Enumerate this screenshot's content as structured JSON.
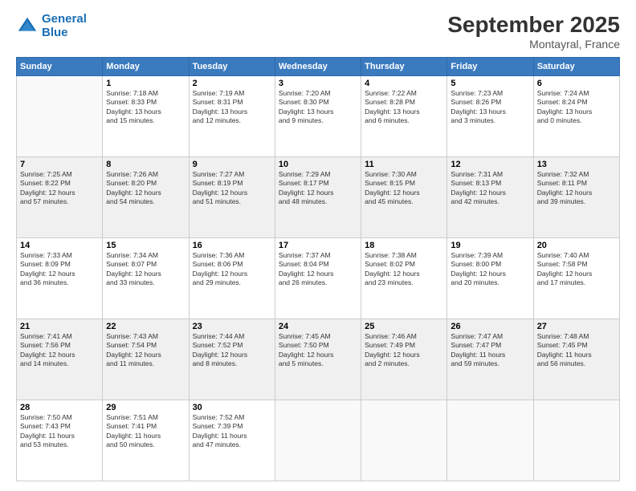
{
  "logo": {
    "line1": "General",
    "line2": "Blue"
  },
  "title": "September 2025",
  "subtitle": "Montayral, France",
  "header_days": [
    "Sunday",
    "Monday",
    "Tuesday",
    "Wednesday",
    "Thursday",
    "Friday",
    "Saturday"
  ],
  "weeks": [
    [
      {
        "day": "",
        "info": ""
      },
      {
        "day": "1",
        "info": "Sunrise: 7:18 AM\nSunset: 8:33 PM\nDaylight: 13 hours\nand 15 minutes."
      },
      {
        "day": "2",
        "info": "Sunrise: 7:19 AM\nSunset: 8:31 PM\nDaylight: 13 hours\nand 12 minutes."
      },
      {
        "day": "3",
        "info": "Sunrise: 7:20 AM\nSunset: 8:30 PM\nDaylight: 13 hours\nand 9 minutes."
      },
      {
        "day": "4",
        "info": "Sunrise: 7:22 AM\nSunset: 8:28 PM\nDaylight: 13 hours\nand 6 minutes."
      },
      {
        "day": "5",
        "info": "Sunrise: 7:23 AM\nSunset: 8:26 PM\nDaylight: 13 hours\nand 3 minutes."
      },
      {
        "day": "6",
        "info": "Sunrise: 7:24 AM\nSunset: 8:24 PM\nDaylight: 13 hours\nand 0 minutes."
      }
    ],
    [
      {
        "day": "7",
        "info": "Sunrise: 7:25 AM\nSunset: 8:22 PM\nDaylight: 12 hours\nand 57 minutes."
      },
      {
        "day": "8",
        "info": "Sunrise: 7:26 AM\nSunset: 8:20 PM\nDaylight: 12 hours\nand 54 minutes."
      },
      {
        "day": "9",
        "info": "Sunrise: 7:27 AM\nSunset: 8:19 PM\nDaylight: 12 hours\nand 51 minutes."
      },
      {
        "day": "10",
        "info": "Sunrise: 7:29 AM\nSunset: 8:17 PM\nDaylight: 12 hours\nand 48 minutes."
      },
      {
        "day": "11",
        "info": "Sunrise: 7:30 AM\nSunset: 8:15 PM\nDaylight: 12 hours\nand 45 minutes."
      },
      {
        "day": "12",
        "info": "Sunrise: 7:31 AM\nSunset: 8:13 PM\nDaylight: 12 hours\nand 42 minutes."
      },
      {
        "day": "13",
        "info": "Sunrise: 7:32 AM\nSunset: 8:11 PM\nDaylight: 12 hours\nand 39 minutes."
      }
    ],
    [
      {
        "day": "14",
        "info": "Sunrise: 7:33 AM\nSunset: 8:09 PM\nDaylight: 12 hours\nand 36 minutes."
      },
      {
        "day": "15",
        "info": "Sunrise: 7:34 AM\nSunset: 8:07 PM\nDaylight: 12 hours\nand 33 minutes."
      },
      {
        "day": "16",
        "info": "Sunrise: 7:36 AM\nSunset: 8:06 PM\nDaylight: 12 hours\nand 29 minutes."
      },
      {
        "day": "17",
        "info": "Sunrise: 7:37 AM\nSunset: 8:04 PM\nDaylight: 12 hours\nand 26 minutes."
      },
      {
        "day": "18",
        "info": "Sunrise: 7:38 AM\nSunset: 8:02 PM\nDaylight: 12 hours\nand 23 minutes."
      },
      {
        "day": "19",
        "info": "Sunrise: 7:39 AM\nSunset: 8:00 PM\nDaylight: 12 hours\nand 20 minutes."
      },
      {
        "day": "20",
        "info": "Sunrise: 7:40 AM\nSunset: 7:58 PM\nDaylight: 12 hours\nand 17 minutes."
      }
    ],
    [
      {
        "day": "21",
        "info": "Sunrise: 7:41 AM\nSunset: 7:56 PM\nDaylight: 12 hours\nand 14 minutes."
      },
      {
        "day": "22",
        "info": "Sunrise: 7:43 AM\nSunset: 7:54 PM\nDaylight: 12 hours\nand 11 minutes."
      },
      {
        "day": "23",
        "info": "Sunrise: 7:44 AM\nSunset: 7:52 PM\nDaylight: 12 hours\nand 8 minutes."
      },
      {
        "day": "24",
        "info": "Sunrise: 7:45 AM\nSunset: 7:50 PM\nDaylight: 12 hours\nand 5 minutes."
      },
      {
        "day": "25",
        "info": "Sunrise: 7:46 AM\nSunset: 7:49 PM\nDaylight: 12 hours\nand 2 minutes."
      },
      {
        "day": "26",
        "info": "Sunrise: 7:47 AM\nSunset: 7:47 PM\nDaylight: 11 hours\nand 59 minutes."
      },
      {
        "day": "27",
        "info": "Sunrise: 7:48 AM\nSunset: 7:45 PM\nDaylight: 11 hours\nand 56 minutes."
      }
    ],
    [
      {
        "day": "28",
        "info": "Sunrise: 7:50 AM\nSunset: 7:43 PM\nDaylight: 11 hours\nand 53 minutes."
      },
      {
        "day": "29",
        "info": "Sunrise: 7:51 AM\nSunset: 7:41 PM\nDaylight: 11 hours\nand 50 minutes."
      },
      {
        "day": "30",
        "info": "Sunrise: 7:52 AM\nSunset: 7:39 PM\nDaylight: 11 hours\nand 47 minutes."
      },
      {
        "day": "",
        "info": ""
      },
      {
        "day": "",
        "info": ""
      },
      {
        "day": "",
        "info": ""
      },
      {
        "day": "",
        "info": ""
      }
    ]
  ]
}
